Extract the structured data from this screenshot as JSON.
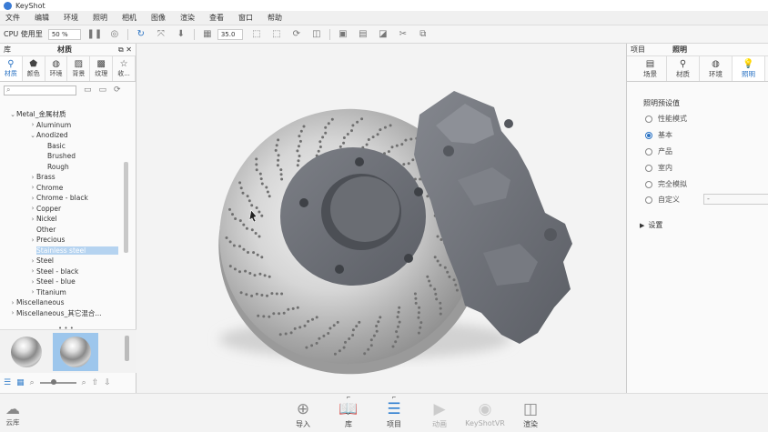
{
  "app": {
    "title": "KeyShot"
  },
  "menu": [
    "文件",
    "编辑",
    "环境",
    "照明",
    "相机",
    "图像",
    "渲染",
    "查看",
    "窗口",
    "帮助"
  ],
  "toolbar": {
    "cpu_label": "CPU 使用里",
    "zoom": "50 %",
    "value_field": "35.0"
  },
  "left_panel": {
    "header_left": "库",
    "header_center": "材质",
    "tabs": [
      {
        "label": "材质",
        "icon": "material-icon",
        "active": true
      },
      {
        "label": "颜色",
        "icon": "color-icon",
        "active": false
      },
      {
        "label": "环境",
        "icon": "environment-icon",
        "active": false
      },
      {
        "label": "背景",
        "icon": "background-icon",
        "active": false
      },
      {
        "label": "纹理",
        "icon": "texture-icon",
        "active": false
      },
      {
        "label": "收...",
        "icon": "favorites-icon",
        "active": false
      }
    ],
    "search": {
      "placeholder": ""
    },
    "tree": [
      {
        "label": "Metal_金属材质",
        "depth": 0,
        "arrow": "open"
      },
      {
        "label": "Aluminum",
        "depth": 1,
        "arrow": "closed"
      },
      {
        "label": "Anodized",
        "depth": 1,
        "arrow": "open"
      },
      {
        "label": "Basic",
        "depth": 2,
        "arrow": ""
      },
      {
        "label": "Brushed",
        "depth": 2,
        "arrow": ""
      },
      {
        "label": "Rough",
        "depth": 2,
        "arrow": ""
      },
      {
        "label": "Brass",
        "depth": 1,
        "arrow": "closed"
      },
      {
        "label": "Chrome",
        "depth": 1,
        "arrow": "closed"
      },
      {
        "label": "Chrome - black",
        "depth": 1,
        "arrow": "closed"
      },
      {
        "label": "Copper",
        "depth": 1,
        "arrow": "closed"
      },
      {
        "label": "Nickel",
        "depth": 1,
        "arrow": "closed"
      },
      {
        "label": "Other",
        "depth": 1,
        "arrow": ""
      },
      {
        "label": "Precious",
        "depth": 1,
        "arrow": "closed"
      },
      {
        "label": "Stainless steel",
        "depth": 1,
        "arrow": "",
        "selected": true
      },
      {
        "label": "Steel",
        "depth": 1,
        "arrow": "closed"
      },
      {
        "label": "Steel - black",
        "depth": 1,
        "arrow": "closed"
      },
      {
        "label": "Steel - blue",
        "depth": 1,
        "arrow": "closed"
      },
      {
        "label": "Titanium",
        "depth": 1,
        "arrow": "closed"
      },
      {
        "label": "Miscellaneous",
        "depth": 0,
        "arrow": "closed"
      },
      {
        "label": "Miscellaneous_其它混合...",
        "depth": 0,
        "arrow": "closed"
      }
    ],
    "more_indicator": "• • •"
  },
  "right_panel": {
    "header_left": "项目",
    "header_center": "照明",
    "tabs": [
      {
        "label": "场景",
        "icon": "scene-icon",
        "active": false
      },
      {
        "label": "材质",
        "icon": "material-icon",
        "active": false
      },
      {
        "label": "环境",
        "icon": "environment-icon",
        "active": false
      },
      {
        "label": "照明",
        "icon": "lighting-icon",
        "active": true
      }
    ],
    "preset_title": "照明预设值",
    "presets": [
      {
        "label": "性能模式",
        "checked": false
      },
      {
        "label": "基本",
        "checked": true
      },
      {
        "label": "产品",
        "checked": false
      },
      {
        "label": "室内",
        "checked": false
      },
      {
        "label": "完全模拟",
        "checked": false
      },
      {
        "label": "自定义",
        "checked": false
      }
    ],
    "custom_select": "-",
    "settings_label": "设置"
  },
  "bottom": {
    "cloud_label": "云库",
    "buttons": [
      {
        "label": "导入",
        "icon": "import-icon",
        "state": "normal"
      },
      {
        "label": "库",
        "icon": "library-icon",
        "state": "blue"
      },
      {
        "label": "项目",
        "icon": "project-icon",
        "state": "blue"
      },
      {
        "label": "动画",
        "icon": "animation-icon",
        "state": "dim"
      },
      {
        "label": "KeyShotVR",
        "icon": "keyshotvr-icon",
        "state": "dim"
      },
      {
        "label": "渲染",
        "icon": "render-icon",
        "state": "normal"
      }
    ]
  },
  "colors": {
    "accent": "#2a73c4",
    "selection": "#b5d3f0",
    "caliper": "#6e7178"
  }
}
